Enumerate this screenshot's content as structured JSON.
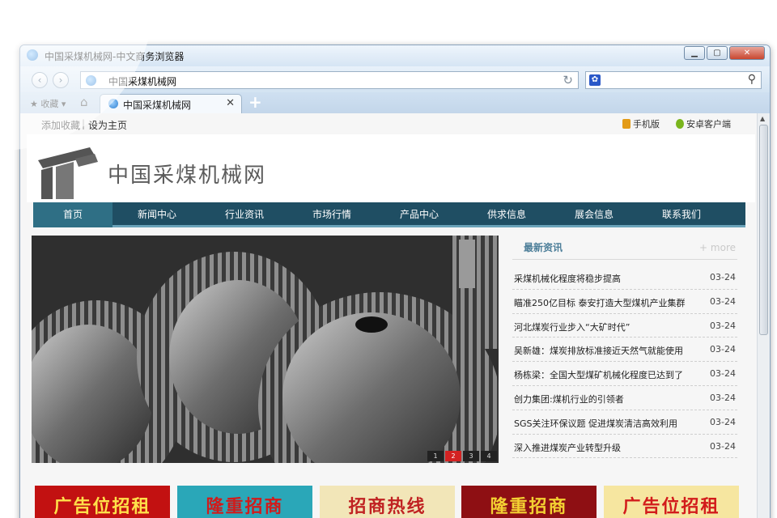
{
  "browser": {
    "title": "中国采煤机械网-中文商务浏览器",
    "address_visible": "中国采煤",
    "address_rest": "机械网",
    "favorites_label": "收藏",
    "tab_label": "中国采煤机械网",
    "tab_label_visible": "中国采",
    "window_controls": [
      "minimize",
      "maximize",
      "close"
    ]
  },
  "site": {
    "top_links": [
      "添加收藏",
      "设为主页"
    ],
    "top_right": [
      "手机版",
      "安卓客户端"
    ],
    "logo_text": "中国采煤机械网",
    "nav": [
      "首页",
      "新闻中心",
      "行业资讯",
      "市场行情",
      "产品中心",
      "供求信息",
      "展会信息",
      "联系我们"
    ],
    "nav_active": "首页",
    "slider": {
      "pages": [
        "1",
        "2",
        "3",
        "4"
      ],
      "active_page": "2"
    },
    "latest_news": {
      "title": "最新资讯",
      "more": "+ more",
      "items": [
        {
          "text": "采煤机械化程度将稳步提高",
          "date": "03-24"
        },
        {
          "text": "瞄准250亿目标 泰安打造大型煤机产业集群",
          "date": "03-24"
        },
        {
          "text": "河北煤炭行业步入“大矿时代”",
          "date": "03-24"
        },
        {
          "text": "吴新雄：煤炭排放标准接近天然气就能使用",
          "date": "03-24"
        },
        {
          "text": "杨栋梁：全国大型煤矿机械化程度已达到了",
          "date": "03-24"
        },
        {
          "text": "创力集团:煤机行业的引领者",
          "date": "03-24"
        },
        {
          "text": "SGS关注环保议题 促进煤炭清洁高效利用",
          "date": "03-24"
        },
        {
          "text": "深入推进煤炭产业转型升级",
          "date": "03-24"
        }
      ]
    },
    "ads": [
      {
        "text": "广告位招租",
        "bg": "#c21111",
        "fg": "#ffe14a"
      },
      {
        "text": "隆重招商",
        "bg": "#2aa7b8",
        "fg": "#d11b1b"
      },
      {
        "text": "招商热线",
        "bg": "#f2e6b8",
        "fg": "#c02222"
      },
      {
        "text": "隆重招商",
        "bg": "#8e0f13",
        "fg": "#f3d032"
      },
      {
        "text": "广告位招租",
        "bg": "#f6e6a0",
        "fg": "#d21b1b"
      }
    ]
  },
  "colors": {
    "nav_bg": "#1f4e63",
    "nav_active": "#2f6f85",
    "news_title": "#4b7d98"
  }
}
